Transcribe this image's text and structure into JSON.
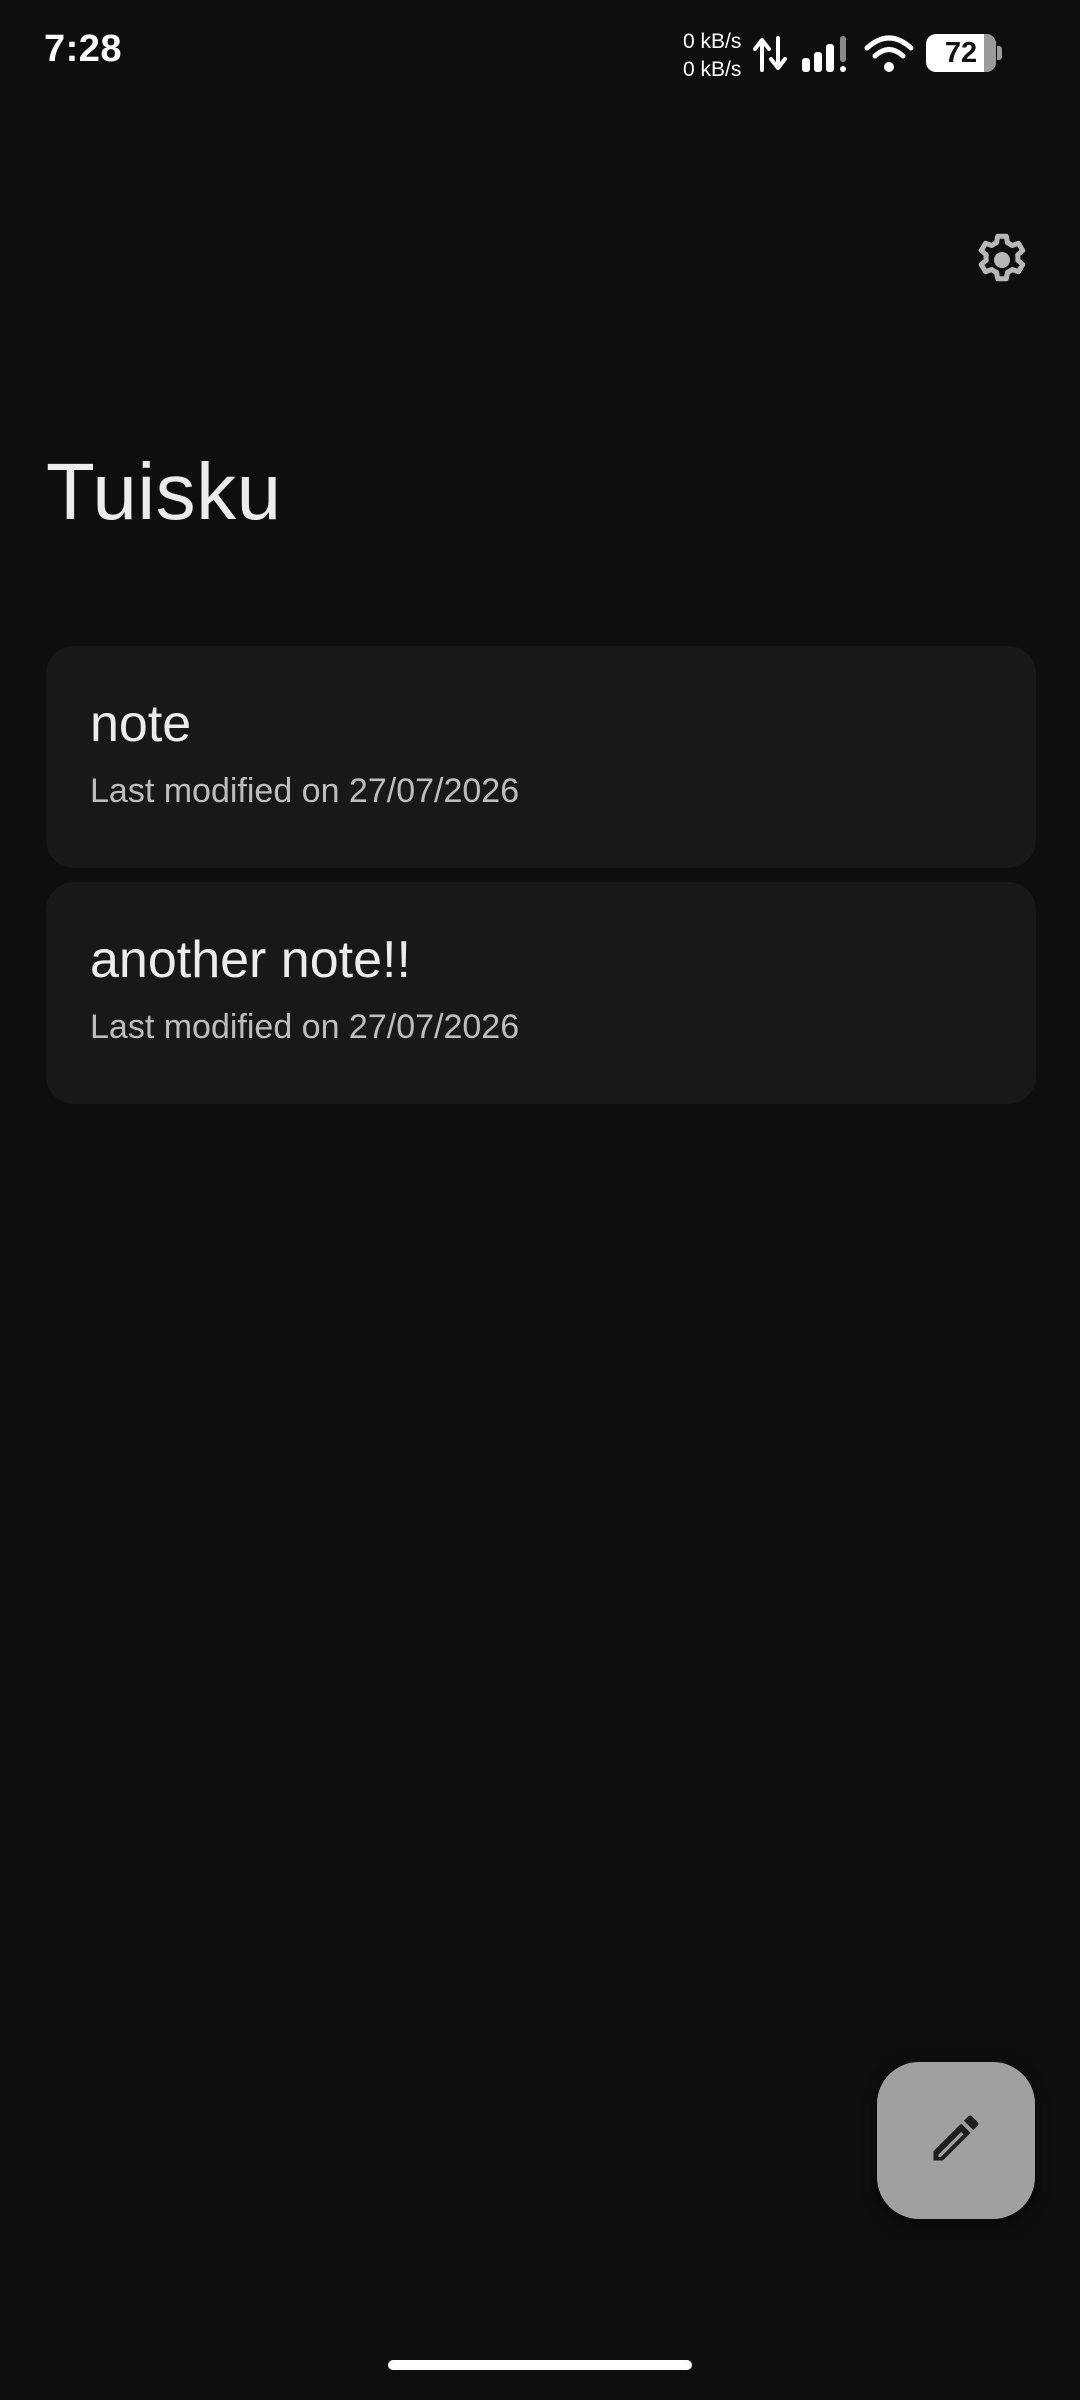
{
  "status_bar": {
    "time": "7:28",
    "net_up": "0 kB/s",
    "net_down": "0 kB/s",
    "battery_level": "72",
    "icons": [
      "data-transfer-icon",
      "signal-icon",
      "wifi-icon",
      "battery-icon"
    ]
  },
  "header": {
    "settings_icon": "gear-icon"
  },
  "app": {
    "title": "Tuisku"
  },
  "notes": [
    {
      "title": "note",
      "meta": "Last modified on 27/07/2026"
    },
    {
      "title": "another note!!",
      "meta": "Last modified on 27/07/2026"
    }
  ],
  "fab": {
    "icon": "pencil-icon"
  },
  "colors": {
    "background": "#0e0e0e",
    "card": "#181818",
    "fab": "#a0a0a0",
    "text_primary": "#ececec",
    "text_secondary": "#bdbdbd"
  }
}
